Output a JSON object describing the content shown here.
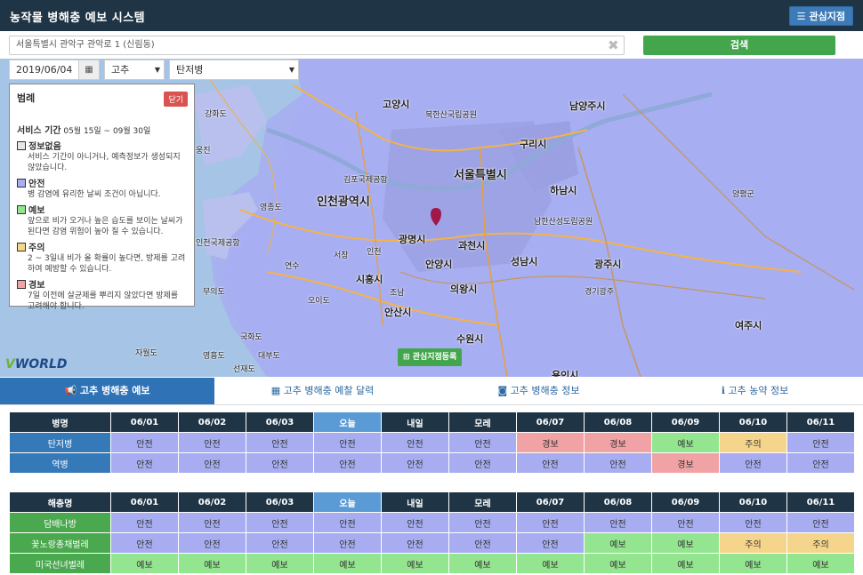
{
  "header": {
    "title": "농작물 병해충 예보 시스템",
    "fav_button": "관심지점"
  },
  "search": {
    "address": "서울특별시 관악구 관악로 1 (신림동)",
    "button": "검색"
  },
  "controls": {
    "date": "2019/06/04",
    "crop": "고추",
    "disease": "탄저병"
  },
  "legend": {
    "title": "범례",
    "close": "닫기",
    "period_label": "서비스 기간",
    "period_value": "05월 15일 ~ 09월 30일",
    "items": [
      {
        "name": "정보없음",
        "color": "#e6e6e6",
        "desc": "서비스 기간이 아니거나, 예측정보가 생성되지 않았습니다."
      },
      {
        "name": "안전",
        "color": "#a7adf0",
        "desc": "병 감염에 유리한 날씨 조건이 아닙니다."
      },
      {
        "name": "예보",
        "color": "#93e58f",
        "desc": "앞으로 비가 오거나 높은 습도를 보이는 날씨가 된다면 감염 위험이 높아 질 수 있습니다."
      },
      {
        "name": "주의",
        "color": "#f5d58b",
        "desc": "2 ~ 3일내 비가 올 확률이 높다면, 방제를 고려하여 예방할 수 있습니다."
      },
      {
        "name": "경보",
        "color": "#f0a2a4",
        "desc": "7일 이전에 살균제를 뿌리지 않았다면 방제를 고려해야 합니다."
      }
    ]
  },
  "map": {
    "labels": [
      "고양시",
      "남양주시",
      "구리시",
      "서울특별시",
      "인천광역시",
      "하남시",
      "광명시",
      "과천시",
      "성남시",
      "광주시",
      "시흥시",
      "안양시",
      "의왕시",
      "안산시",
      "수원시",
      "여주시",
      "용인시",
      "양평군",
      "강화도",
      "영종도",
      "연수",
      "서창",
      "인천",
      "조남",
      "오이도",
      "국화도",
      "자월도",
      "대부도",
      "선재도",
      "영흥도",
      "북한산국립공원",
      "남한산성도립공원",
      "김포국제공항",
      "인천국제공항",
      "경기광주",
      "웅진",
      "무의도"
    ],
    "vworld": [
      "V",
      "WORLD"
    ],
    "register_button": "관심지점등록"
  },
  "tabs": [
    "고추 병해충 예보",
    "고추 병해충 예찰 달력",
    "고추 병해충 정보",
    "고추 농약 정보"
  ],
  "disease_table": {
    "header": [
      "병명",
      "06/01",
      "06/02",
      "06/03",
      "오늘",
      "내일",
      "모레",
      "06/07",
      "06/08",
      "06/09",
      "06/10",
      "06/11"
    ],
    "rows": [
      {
        "name": "탄저병",
        "cells": [
          "안전",
          "안전",
          "안전",
          "안전",
          "안전",
          "안전",
          "경보",
          "경보",
          "예보",
          "주의",
          "안전"
        ]
      },
      {
        "name": "역병",
        "cells": [
          "안전",
          "안전",
          "안전",
          "안전",
          "안전",
          "안전",
          "안전",
          "안전",
          "경보",
          "안전",
          "안전"
        ]
      }
    ]
  },
  "pest_table": {
    "header": [
      "해충명",
      "06/01",
      "06/02",
      "06/03",
      "오늘",
      "내일",
      "모레",
      "06/07",
      "06/08",
      "06/09",
      "06/10",
      "06/11"
    ],
    "rows": [
      {
        "name": "담배나방",
        "cells": [
          "안전",
          "안전",
          "안전",
          "안전",
          "안전",
          "안전",
          "안전",
          "안전",
          "안전",
          "안전",
          "안전"
        ]
      },
      {
        "name": "꽃노랑총채벌레",
        "cells": [
          "안전",
          "안전",
          "안전",
          "안전",
          "안전",
          "안전",
          "안전",
          "예보",
          "예보",
          "주의",
          "주의"
        ]
      },
      {
        "name": "미국선녀벌레",
        "cells": [
          "예보",
          "예보",
          "예보",
          "예보",
          "예보",
          "예보",
          "예보",
          "예보",
          "예보",
          "예보",
          "예보"
        ]
      }
    ]
  },
  "status_colors": {
    "안전": "#a7adf0",
    "예보": "#93e58f",
    "주의": "#f5d58b",
    "경보": "#f0a2a4"
  }
}
